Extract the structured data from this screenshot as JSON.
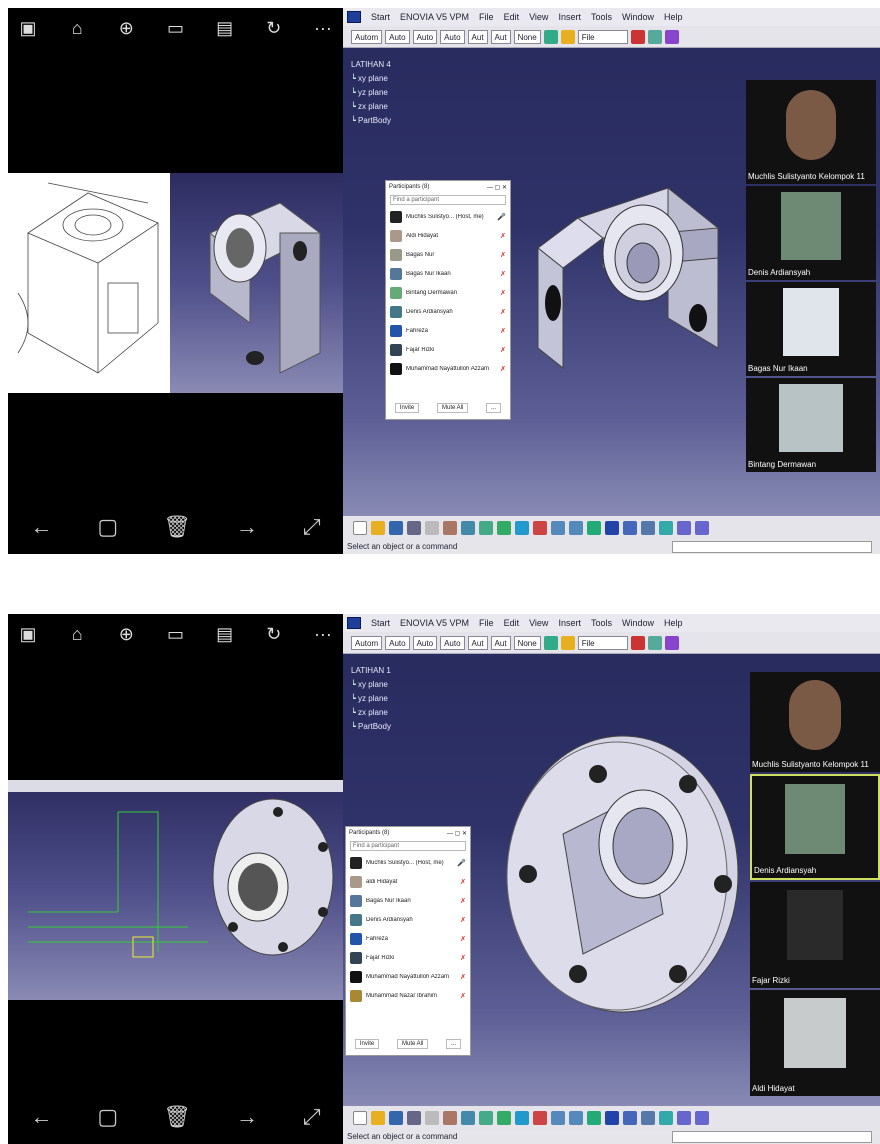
{
  "viewer": {
    "top_icons": [
      "image-icon",
      "home-icon",
      "zoom-icon",
      "frame-icon",
      "save-icon",
      "rotate-icon",
      "more-icon"
    ],
    "more_glyph": "···",
    "bottom_icons": [
      "back-arrow-icon",
      "crop-icon",
      "delete-icon",
      "forward-arrow-icon",
      "expand-icon"
    ]
  },
  "catia": {
    "menus": [
      "Start",
      "ENOVIA V5 VPM",
      "File",
      "Edit",
      "View",
      "Insert",
      "Tools",
      "Window",
      "Help"
    ],
    "toolbar_dropdowns": [
      "Autom",
      "Auto",
      "Auto",
      "Auto",
      "Aut",
      "Aut",
      "None"
    ],
    "toolbar_file": "File",
    "status": "Select an object or a command"
  },
  "screen1": {
    "tree_root": "LATIHAN 4",
    "tree_items": [
      "xy plane",
      "yz plane",
      "zx plane",
      "PartBody"
    ],
    "participants_title": "Participants (8)",
    "participants_search": "Find a participant",
    "participants": [
      "Muchlis Sulistyo... (Host, me)",
      "Aldi Hidayat",
      "Bagas Nur",
      "Bagas Nur Ikaan",
      "Bintang Dermawan",
      "Denis Ardiansyah",
      "Fahreza",
      "Fajar Rizki",
      "Muhammad Nayattulloh Azzam"
    ],
    "footer_buttons": [
      "Invite",
      "Mute All",
      "..."
    ],
    "videos": [
      "Muchlis Sulistyanto Kelompok 11",
      "Denis Ardiansyah",
      "Bagas Nur Ikaan",
      "Bintang Dermawan"
    ]
  },
  "screen2": {
    "tree_root": "LATIHAN 1",
    "tree_items": [
      "xy plane",
      "yz plane",
      "zx plane",
      "PartBody"
    ],
    "participants_title": "Participants (8)",
    "participants_search": "Find a participant",
    "participants": [
      "Muchlis Sulistyo... (Host, me)",
      "aldi Hidayat",
      "Bagas Nur Ikaan",
      "Denis Ardiansyah",
      "Fahreza",
      "Fajar Rizki",
      "Muhammad Nayattulloh Azzam",
      "Muhammad Nazar Ibrahim"
    ],
    "footer_buttons": [
      "Invite",
      "Mute All",
      "..."
    ],
    "videos": [
      "Muchlis Sulistyanto Kelompok 11",
      "Denis Ardiansyah",
      "Fajar Rizki",
      "Aldi Hidayat"
    ]
  }
}
